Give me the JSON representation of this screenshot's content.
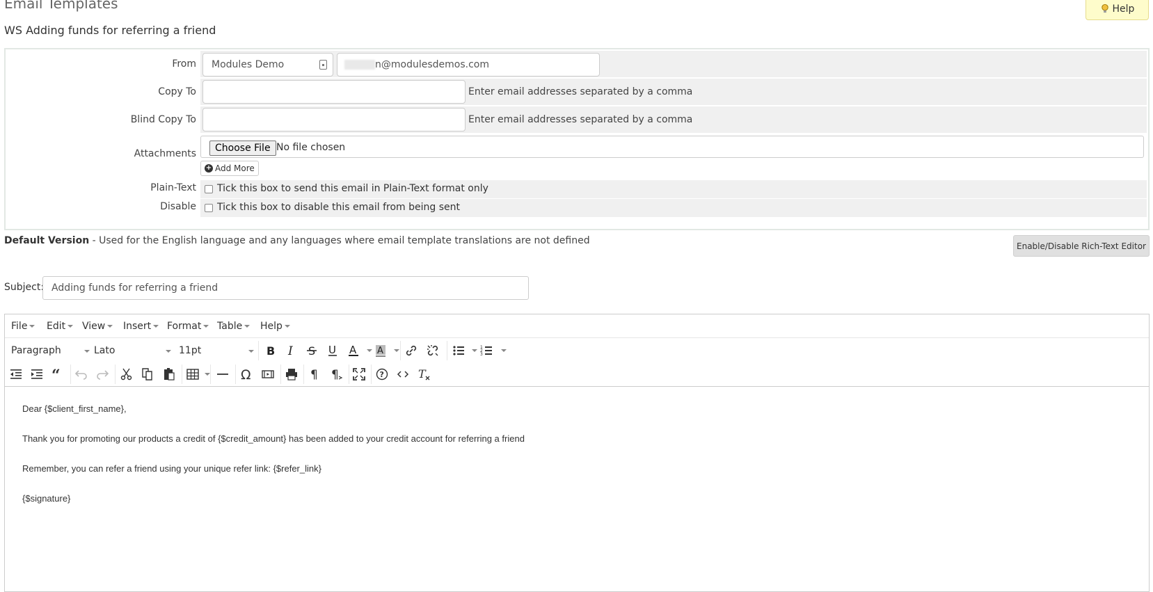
{
  "page": {
    "title": "Email Templates",
    "help_label": "Help",
    "template_name": "WS Adding funds for referring a friend"
  },
  "form": {
    "from_label": "From",
    "from_name": "Modules Demo",
    "from_email": "n@modulesdemos.com",
    "copy_to_label": "Copy To",
    "copy_to_value": "",
    "copy_to_hint": "Enter email addresses separated by a comma",
    "bcc_label": "Blind Copy To",
    "bcc_value": "",
    "bcc_hint": "Enter email addresses separated by a comma",
    "attachments_label": "Attachments",
    "choose_file_label": "Choose File",
    "no_file_text": "No file chosen",
    "add_more_label": "Add More",
    "plain_text_label": "Plain-Text",
    "plain_text_hint": "Tick this box to send this email in Plain-Text format only",
    "disable_label": "Disable",
    "disable_hint": "Tick this box to disable this email from being sent"
  },
  "default_version": {
    "bold_label": "Default Version",
    "description": " - Used for the English language and any languages where email template translations are not defined",
    "rte_toggle_label": "Enable/Disable Rich-Text Editor"
  },
  "subject": {
    "label": "Subject:",
    "value": "Adding funds for referring a friend"
  },
  "editor": {
    "menu": [
      "File",
      "Edit",
      "View",
      "Insert",
      "Format",
      "Table",
      "Help"
    ],
    "block_format": "Paragraph",
    "font_family": "Lato",
    "font_size": "11pt",
    "body": [
      "Dear {$client_first_name},",
      "Thank you for promoting our products a credit of {$credit_amount} has been added to your credit account for referring a friend",
      "Remember, you can refer a friend using your unique refer link: {$refer_link}",
      "{$signature}"
    ]
  }
}
